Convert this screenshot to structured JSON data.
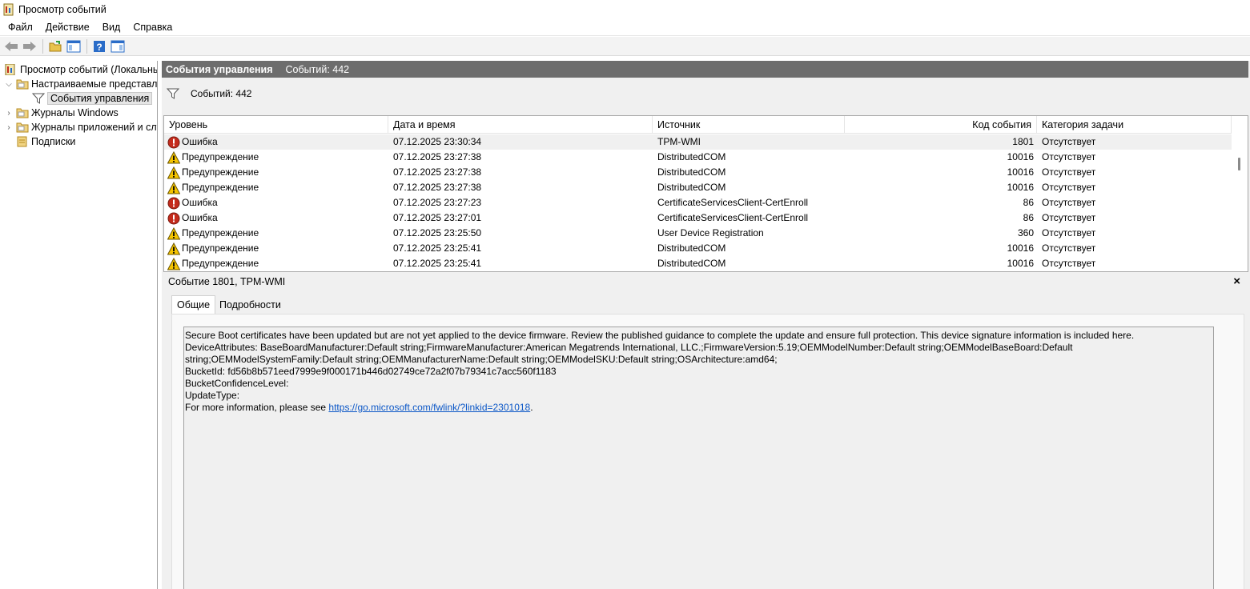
{
  "window": {
    "title": "Просмотр событий"
  },
  "menu": [
    "Файл",
    "Действие",
    "Вид",
    "Справка"
  ],
  "tree": {
    "root": "Просмотр событий (Локальный)",
    "custom_views": "Настраиваемые представления",
    "admin_events": "События управления",
    "windows_logs": "Журналы Windows",
    "app_logs": "Журналы приложений и служб",
    "subscriptions": "Подписки"
  },
  "header": {
    "title": "События управления",
    "count": "Событий: 442"
  },
  "filter": {
    "count": "Событий: 442"
  },
  "columns": [
    "Уровень",
    "Дата и время",
    "Источник",
    "Код события",
    "Категория задачи"
  ],
  "events": [
    {
      "level": "Ошибка",
      "type": "error",
      "date": "07.12.2025 23:30:34",
      "source": "TPM-WMI",
      "code": "1801",
      "category": "Отсутствует"
    },
    {
      "level": "Предупреждение",
      "type": "warning",
      "date": "07.12.2025 23:27:38",
      "source": "DistributedCOM",
      "code": "10016",
      "category": "Отсутствует"
    },
    {
      "level": "Предупреждение",
      "type": "warning",
      "date": "07.12.2025 23:27:38",
      "source": "DistributedCOM",
      "code": "10016",
      "category": "Отсутствует"
    },
    {
      "level": "Предупреждение",
      "type": "warning",
      "date": "07.12.2025 23:27:38",
      "source": "DistributedCOM",
      "code": "10016",
      "category": "Отсутствует"
    },
    {
      "level": "Ошибка",
      "type": "error",
      "date": "07.12.2025 23:27:23",
      "source": "CertificateServicesClient-CertEnroll",
      "code": "86",
      "category": "Отсутствует"
    },
    {
      "level": "Ошибка",
      "type": "error",
      "date": "07.12.2025 23:27:01",
      "source": "CertificateServicesClient-CertEnroll",
      "code": "86",
      "category": "Отсутствует"
    },
    {
      "level": "Предупреждение",
      "type": "warning",
      "date": "07.12.2025 23:25:50",
      "source": "User Device Registration",
      "code": "360",
      "category": "Отсутствует"
    },
    {
      "level": "Предупреждение",
      "type": "warning",
      "date": "07.12.2025 23:25:41",
      "source": "DistributedCOM",
      "code": "10016",
      "category": "Отсутствует"
    },
    {
      "level": "Предупреждение",
      "type": "warning",
      "date": "07.12.2025 23:25:41",
      "source": "DistributedCOM",
      "code": "10016",
      "category": "Отсутствует"
    }
  ],
  "detail": {
    "title": "Событие 1801, TPM-WMI",
    "close": "×",
    "tabs": [
      "Общие",
      "Подробности"
    ],
    "lines": [
      "Secure Boot certificates have been updated but are not yet applied to the device firmware. Review the published guidance to complete the update and ensure full protection. This device signature information is included here.",
      "DeviceAttributes: BaseBoardManufacturer:Default string;FirmwareManufacturer:American Megatrends International, LLC.;FirmwareVersion:5.19;OEMModelNumber:Default string;OEMModelBaseBoard:Default",
      "string;OEMModelSystemFamily:Default string;OEMManufacturerName:Default string;OEMModelSKU:Default string;OSArchitecture:amd64;",
      "BucketId: fd56b8b571eed7999e9f000171b446d02749ce72a2f07b79341c7acc560f1183",
      "BucketConfidenceLevel:",
      "UpdateType:"
    ],
    "more_info_prefix": "For more information, please see ",
    "link": "https://go.microsoft.com/fwlink/?linkid=2301018",
    "more_info_suffix": "."
  },
  "colors": {
    "header_bg": "#6d6d6d",
    "link": "#0b57c7",
    "error": "#c42b1c",
    "warning": "#f5c400"
  }
}
